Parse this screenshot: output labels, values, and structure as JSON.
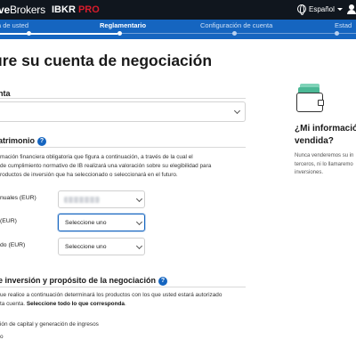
{
  "header": {
    "brand_bold": "ve",
    "brand_rest": "Brokers",
    "product": "IBKR",
    "product_suffix": "PRO",
    "language": "Español",
    "user_icon": "user-icon"
  },
  "steps": [
    {
      "label": "a de usted"
    },
    {
      "label": "Reglamentario"
    },
    {
      "label": "Configuración de cuenta"
    },
    {
      "label": "Estad"
    }
  ],
  "progress_fraction": 0.33,
  "page": {
    "title": "ure su cuenta de negociación"
  },
  "account": {
    "label": "nta"
  },
  "patrimonio": {
    "label": "atrimonio",
    "help_icon": "?",
    "paragraph_lines": [
      "mación financiera obligatoria que figura a continuación, a través de la cual el",
      "de cumplimiento normativo de IB realizará una valoración sobre su elegibilidad para",
      "roductos de inversión que ha seleccionado o seleccionará en el futuro."
    ],
    "fields": [
      {
        "label": "nuales (EUR)",
        "value": ""
      },
      {
        "label": "(EUR)",
        "value": "Seleccione uno"
      },
      {
        "label": "do (EUR)",
        "value": "Seleccione uno"
      }
    ]
  },
  "objectives": {
    "label": "e inversión y propósito de la negociación",
    "help_icon": "?",
    "paragraph_line1": "ue realice a continuación determinará los productos con los que usted estará autorizado",
    "paragraph_line2_plain": "ta cuenta. ",
    "paragraph_line2_bold": "Seleccione todo lo que corresponda",
    "paragraph_line2_end": ".",
    "options": [
      "ión de capital y generación de ingresos",
      "o"
    ]
  },
  "sidebar": {
    "title": "¿Mi informació vendida?",
    "text": "Nunca venderemos su in terceros, ni lo llamaremo inversiones."
  },
  "colors": {
    "topbar": "#10161e",
    "steps_bar": "#1565c0",
    "accent_red": "#d81c2c",
    "wallet_green": "#4bb895"
  }
}
